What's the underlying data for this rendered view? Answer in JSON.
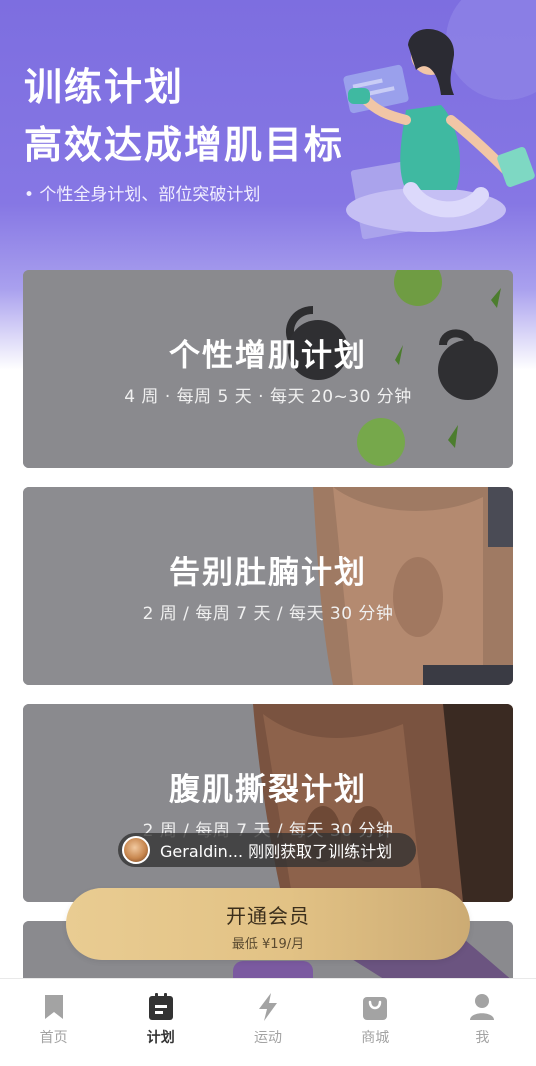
{
  "hero": {
    "title_line1": "训练计划",
    "title_line2": "高效达成增肌目标",
    "subtitle": "• 个性全身计划、部位突破计划"
  },
  "plans": [
    {
      "title": "个性增肌计划",
      "meta": "4 周 · 每周 5 天 · 每天 20~30 分钟"
    },
    {
      "title": "告别肚腩计划",
      "meta": "2 周 / 每周 7 天 / 每天 30 分钟"
    },
    {
      "title": "腹肌撕裂计划",
      "meta": "2 周 / 每周 7 天 / 每天 30 分钟"
    }
  ],
  "toast": {
    "text": "Geraldin... 刚刚获取了训练计划"
  },
  "vip": {
    "label": "开通会员",
    "price": "最低 ¥19/月"
  },
  "tabbar": {
    "items": [
      {
        "label": "首页",
        "icon": "bookmark-icon"
      },
      {
        "label": "计划",
        "icon": "plan-icon"
      },
      {
        "label": "运动",
        "icon": "lightning-icon"
      },
      {
        "label": "商城",
        "icon": "shopping-bag-icon"
      },
      {
        "label": "我",
        "icon": "person-icon"
      }
    ]
  },
  "colors": {
    "hero": "#7d6ee0",
    "vip_gold": "#e2c285",
    "tab_active": "#333333",
    "tab_inactive": "#a3a3a3"
  }
}
